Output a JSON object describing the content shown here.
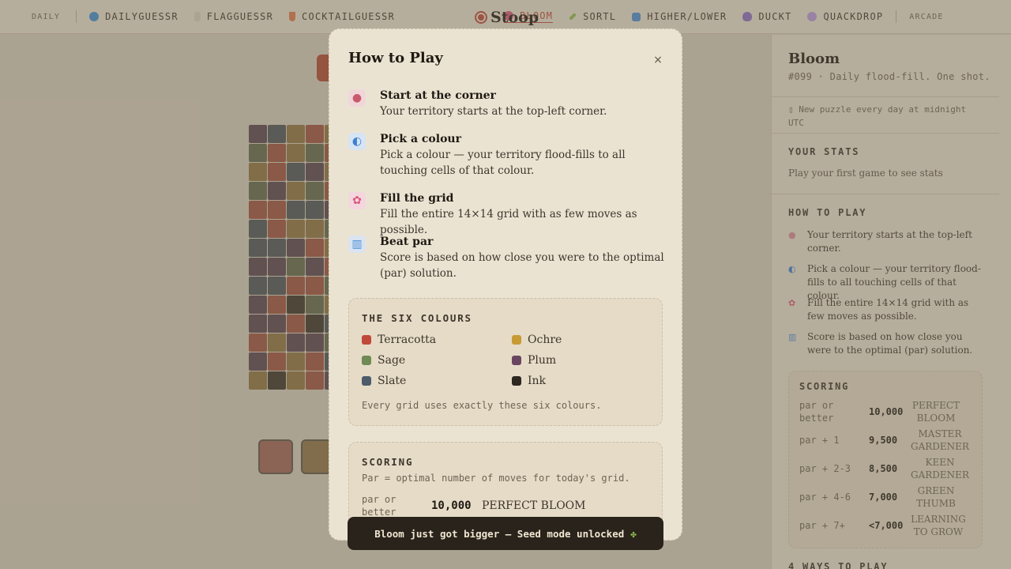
{
  "nav": {
    "daily_label": "DAILY",
    "items": [
      {
        "label": "DAILYGUESSR",
        "icon": "globe-icon",
        "color": "#3f8fd0"
      },
      {
        "label": "FLAGGUESSR",
        "icon": "flag-icon",
        "color": "#cfc6b5"
      },
      {
        "label": "COCKTAILGUESSR",
        "icon": "cocktail-icon",
        "color": "#e07a4c"
      },
      {
        "label": "BLOOM",
        "icon": "flower-icon",
        "color": "#d9577a"
      },
      {
        "label": "SORTL",
        "icon": "pencil-icon",
        "color": "#8fbf4f"
      },
      {
        "label": "HIGHER/LOWER",
        "icon": "up-down-icon",
        "color": "#4a8fd6"
      },
      {
        "label": "DUCKT",
        "icon": "duck-icon",
        "color": "#8a6fc4"
      },
      {
        "label": "QUACKDROP",
        "icon": "drop-icon",
        "color": "#b99ae0"
      }
    ],
    "arcade_label": "ARCADE",
    "brand": "Stoop",
    "hidden_item_fragment": "E"
  },
  "sidebar": {
    "title": "Bloom",
    "subtitle": "#099 · Daily flood-fill. One shot.",
    "note": "New puzzle every day at midnight UTC",
    "note_icon": "calendar-icon",
    "stats_heading": "YOUR STATS",
    "stats_text": "Play your first game to see stats",
    "howto_heading": "HOW TO PLAY",
    "steps": [
      {
        "icon": "palette-icon",
        "text": "Your territory starts at the top-left corner."
      },
      {
        "icon": "wave-icon",
        "text": "Pick a colour — your territory flood-fills to all touching cells of that colour."
      },
      {
        "icon": "flower-icon",
        "text": "Fill the entire 14×14 grid with as few moves as possible."
      },
      {
        "icon": "chart-icon",
        "text": "Score is based on how close you were to the optimal (par) solution."
      }
    ],
    "scoring_heading": "SCORING",
    "scoring_rows": [
      {
        "key": "par or better",
        "value": "10,000",
        "label": "PERFECT BLOOM"
      },
      {
        "key": "par + 1",
        "value": "9,500",
        "label": "MASTER GARDENER"
      },
      {
        "key": "par + 2-3",
        "value": "8,500",
        "label": "KEEN GARDENER"
      },
      {
        "key": "par + 4-6",
        "value": "7,000",
        "label": "GREEN THUMB"
      },
      {
        "key": "par + 7+",
        "value": "<7,000",
        "label": "LEARNING TO GROW"
      }
    ],
    "more_heading": "4 WAYS TO PLAY"
  },
  "modal": {
    "title": "How to Play",
    "close_label": "×",
    "steps": [
      {
        "icon": "palette-icon",
        "title": "Start at the corner",
        "desc": "Your territory starts at the top-left corner."
      },
      {
        "icon": "wave-icon",
        "title": "Pick a colour",
        "desc": "Pick a colour — your territory flood-fills to all touching cells of that colour."
      },
      {
        "icon": "flower-icon",
        "title": "Fill the grid",
        "desc": "Fill the entire 14×14 grid with as few moves as possible."
      },
      {
        "icon": "chart-icon",
        "title": "Beat par",
        "desc": "Score is based on how close you were to the optimal (par) solution."
      }
    ],
    "colours_heading": "THE SIX COLOURS",
    "colours": [
      {
        "name": "Terracotta",
        "hex": "#c0493a"
      },
      {
        "name": "Ochre",
        "hex": "#c89a34"
      },
      {
        "name": "Sage",
        "hex": "#6f8a55"
      },
      {
        "name": "Plum",
        "hex": "#6a4560"
      },
      {
        "name": "Slate",
        "hex": "#4d5c6b"
      },
      {
        "name": "Ink",
        "hex": "#2e2720"
      }
    ],
    "colours_note": "Every grid uses exactly these six colours.",
    "scoring_heading": "SCORING",
    "scoring_sub": "Par = optimal number of moves for today's grid.",
    "scoring_row": {
      "key": "par or better",
      "value": "10,000",
      "label": "PERFECT BLOOM"
    }
  },
  "toast": {
    "text": "Bloom just got bigger — Seed mode unlocked",
    "icon": "seedling-icon"
  },
  "game": {
    "grid_rows": [
      [
        "P",
        "S",
        "O",
        "T",
        "O",
        "S",
        "O",
        "T",
        "P",
        "S",
        "O",
        "G",
        "T",
        "I"
      ],
      [
        "G",
        "T",
        "O",
        "G",
        "T",
        "P",
        "O",
        "S",
        "G",
        "T",
        "O",
        "P",
        "S",
        "G"
      ],
      [
        "O",
        "T",
        "S",
        "P",
        "O",
        "G",
        "T",
        "S",
        "O",
        "P",
        "G",
        "T",
        "I",
        "O"
      ],
      [
        "G",
        "P",
        "O",
        "G",
        "T",
        "S",
        "P",
        "O",
        "G",
        "T",
        "S",
        "P",
        "O",
        "G"
      ],
      [
        "T",
        "T",
        "S",
        "S",
        "P",
        "O",
        "G",
        "T",
        "S",
        "P",
        "O",
        "G",
        "T",
        "S"
      ],
      [
        "S",
        "T",
        "O",
        "O",
        "G",
        "T",
        "S",
        "P",
        "O",
        "G",
        "T",
        "S",
        "P",
        "O"
      ],
      [
        "S",
        "S",
        "P",
        "T",
        "O",
        "G",
        "T",
        "S",
        "P",
        "O",
        "G",
        "T",
        "S",
        "P"
      ],
      [
        "P",
        "P",
        "G",
        "P",
        "T",
        "S",
        "O",
        "G",
        "T",
        "S",
        "P",
        "O",
        "G",
        "T"
      ],
      [
        "S",
        "S",
        "T",
        "T",
        "G",
        "P",
        "S",
        "O",
        "G",
        "T",
        "S",
        "P",
        "O",
        "G"
      ],
      [
        "P",
        "T",
        "I",
        "G",
        "O",
        "T",
        "S",
        "P",
        "O",
        "G",
        "T",
        "S",
        "P",
        "O"
      ],
      [
        "P",
        "P",
        "T",
        "I",
        "S",
        "O",
        "G",
        "T",
        "S",
        "P",
        "O",
        "G",
        "T",
        "S"
      ],
      [
        "T",
        "O",
        "P",
        "P",
        "G",
        "T",
        "S",
        "P",
        "O",
        "G",
        "T",
        "S",
        "P",
        "O"
      ],
      [
        "P",
        "T",
        "O",
        "T",
        "S",
        "P",
        "O",
        "G",
        "T",
        "S",
        "P",
        "O",
        "G",
        "T"
      ],
      [
        "O",
        "I",
        "O",
        "T",
        "P",
        "O",
        "G",
        "T",
        "S",
        "P",
        "O",
        "G",
        "T",
        "S"
      ]
    ],
    "palette_map": {
      "T": "#a0523e",
      "O": "#8f7440",
      "G": "#616a4a",
      "P": "#5a4450",
      "S": "#4d5358",
      "I": "#3a3229"
    },
    "buttons": [
      {
        "name": "terracotta-swatch-button",
        "color": "#a06456"
      },
      {
        "name": "ochre-swatch-button",
        "color": "#8f7447"
      }
    ]
  }
}
